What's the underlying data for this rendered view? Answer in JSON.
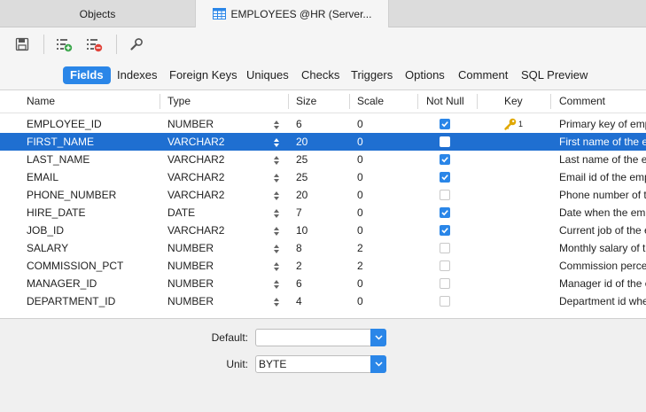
{
  "tabs": [
    {
      "label": "Objects",
      "active": false
    },
    {
      "label": "EMPLOYEES @HR (Server...",
      "active": true,
      "icon": "table-icon"
    }
  ],
  "toolbar": {
    "buttons": [
      {
        "name": "save-icon"
      },
      {
        "name": "add-column-icon"
      },
      {
        "name": "remove-column-icon"
      },
      {
        "name": "wrench-icon"
      }
    ]
  },
  "subtabs": [
    "Fields",
    "Indexes",
    "Foreign Keys",
    "Uniques",
    "Checks",
    "Triggers",
    "Options",
    "Comment",
    "SQL Preview"
  ],
  "active_subtab": "Fields",
  "grid": {
    "headers": [
      "Name",
      "Type",
      "Size",
      "Scale",
      "Not Null",
      "Key",
      "Comment"
    ],
    "rows": [
      {
        "name": "EMPLOYEE_ID",
        "type": "NUMBER",
        "size": "6",
        "scale": "0",
        "not_null": true,
        "key": "1",
        "comment": "Primary key of emp"
      },
      {
        "name": "FIRST_NAME",
        "type": "VARCHAR2",
        "size": "20",
        "scale": "0",
        "not_null": false,
        "key": "",
        "comment": "First name of the er",
        "selected": true
      },
      {
        "name": "LAST_NAME",
        "type": "VARCHAR2",
        "size": "25",
        "scale": "0",
        "not_null": true,
        "key": "",
        "comment": "Last name of the er"
      },
      {
        "name": "EMAIL",
        "type": "VARCHAR2",
        "size": "25",
        "scale": "0",
        "not_null": true,
        "key": "",
        "comment": "Email id of the emp"
      },
      {
        "name": "PHONE_NUMBER",
        "type": "VARCHAR2",
        "size": "20",
        "scale": "0",
        "not_null": false,
        "key": "",
        "comment": "Phone number of th"
      },
      {
        "name": "HIRE_DATE",
        "type": "DATE",
        "size": "7",
        "scale": "0",
        "not_null": true,
        "key": "",
        "comment": "Date when the emp"
      },
      {
        "name": "JOB_ID",
        "type": "VARCHAR2",
        "size": "10",
        "scale": "0",
        "not_null": true,
        "key": "",
        "comment": "Current job of the e"
      },
      {
        "name": "SALARY",
        "type": "NUMBER",
        "size": "8",
        "scale": "2",
        "not_null": false,
        "key": "",
        "comment": "Monthly salary of th"
      },
      {
        "name": "COMMISSION_PCT",
        "type": "NUMBER",
        "size": "2",
        "scale": "2",
        "not_null": false,
        "key": "",
        "comment": "Commission percen"
      },
      {
        "name": "MANAGER_ID",
        "type": "NUMBER",
        "size": "6",
        "scale": "0",
        "not_null": false,
        "key": "",
        "comment": "Manager id of the e"
      },
      {
        "name": "DEPARTMENT_ID",
        "type": "NUMBER",
        "size": "4",
        "scale": "0",
        "not_null": false,
        "key": "",
        "comment": "Department id whe"
      }
    ]
  },
  "properties": {
    "default_label": "Default:",
    "default_value": "",
    "unit_label": "Unit:",
    "unit_value": "BYTE"
  },
  "colors": {
    "accent": "#2a86e8",
    "selection": "#1f6fd1",
    "key_icon": "#e0a800"
  }
}
